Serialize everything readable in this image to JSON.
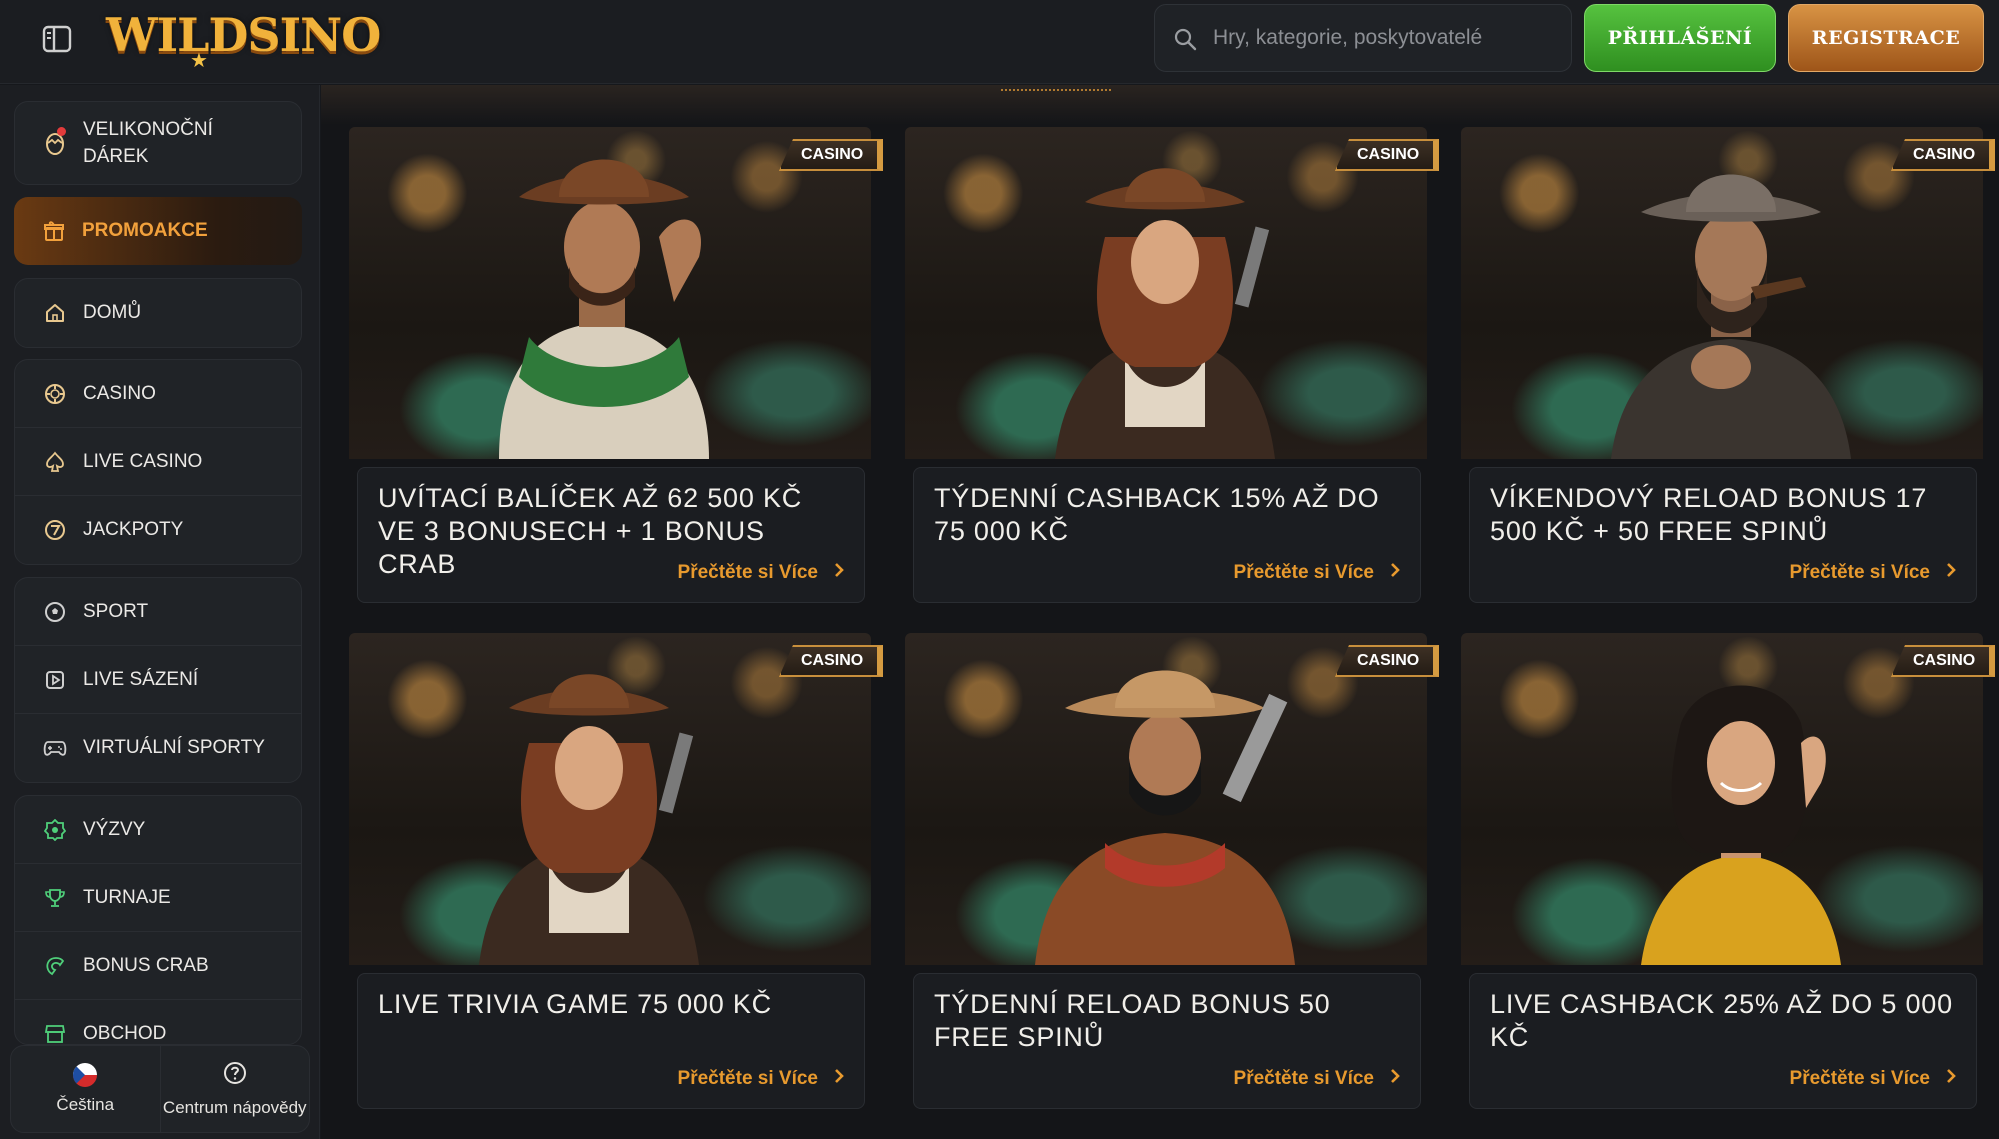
{
  "header": {
    "logo_text": "WILDSINO",
    "search_placeholder": "Hry, kategorie, poskytovatelé",
    "login_label": "PŘIHLÁŠENÍ",
    "register_label": "REGISTRACE"
  },
  "sidebar": {
    "easter_gift": "VELIKONOČNÍ DÁREK",
    "promotions": "PROMOAKCE",
    "home": "DOMŮ",
    "casino": "CASINO",
    "live_casino": "LIVE CASINO",
    "jackpots": "JACKPOTY",
    "sport": "SPORT",
    "live_betting": "LIVE SÁZENÍ",
    "virtual_sports": "VIRTUÁLNÍ SPORTY",
    "challenges": "VÝZVY",
    "tournaments": "TURNAJE",
    "bonus_crab": "BONUS CRAB",
    "shop": "OBCHOD",
    "language": "Čeština",
    "help_center": "Centrum nápovědy"
  },
  "colors": {
    "accent_orange": "#e89a2e",
    "login_green": "#3fa82d",
    "register_brown": "#c17a33",
    "background": "#141518"
  },
  "promos": [
    {
      "badge": "CASINO",
      "title": "UVÍTACÍ BALÍČEK AŽ 62 500 KČ VE 3 BONUSECH + 1 BONUS CRAB",
      "link": "Přečtěte si Více"
    },
    {
      "badge": "CASINO",
      "title": "TÝDENNÍ CASHBACK 15% AŽ DO 75 000 KČ",
      "link": "Přečtěte si Více"
    },
    {
      "badge": "CASINO",
      "title": "VÍKENDOVÝ RELOAD BONUS 17 500 KČ + 50 FREE SPINŮ",
      "link": "Přečtěte si Více"
    },
    {
      "badge": "CASINO",
      "title": "LIVE TRIVIA GAME 75 000 KČ",
      "link": "Přečtěte si Více"
    },
    {
      "badge": "CASINO",
      "title": "TÝDENNÍ RELOAD BONUS 50 FREE SPINŮ",
      "link": "Přečtěte si Více"
    },
    {
      "badge": "CASINO",
      "title": "LIVE CASHBACK 25% AŽ DO 5 000 KČ",
      "link": "Přečtěte si Více"
    }
  ]
}
